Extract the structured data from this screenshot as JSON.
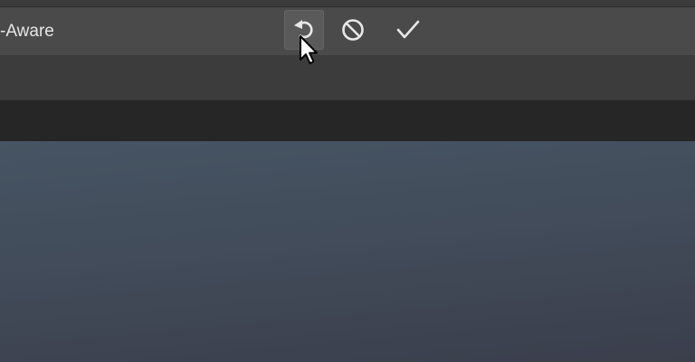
{
  "options_bar": {
    "content_aware_label": "-Aware",
    "reset_icon": "reset-transform-icon",
    "cancel_icon": "cancel-transform-icon",
    "commit_icon": "commit-checkmark-icon"
  },
  "colors": {
    "options_bar_bg": "#4a4a4a",
    "tab_bar_bg": "#262626",
    "canvas_bg": "#424c5a",
    "icon_color": "#e8e8e8"
  }
}
